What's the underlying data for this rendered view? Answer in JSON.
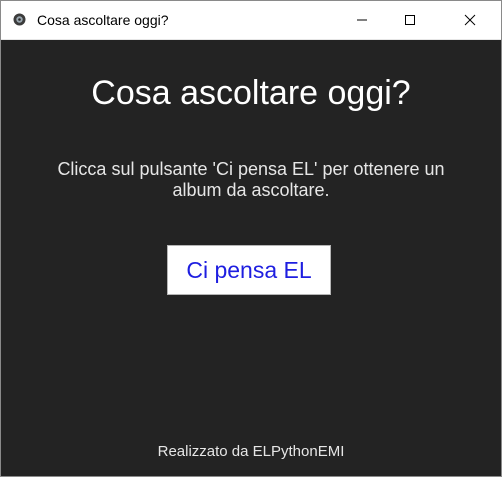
{
  "window": {
    "title": "Cosa ascoltare oggi?",
    "app_icon": "feather-app-icon",
    "controls": {
      "minimize_icon": "minimize-icon",
      "maximize_icon": "maximize-icon",
      "close_icon": "close-icon"
    }
  },
  "main": {
    "heading": "Cosa ascoltare oggi?",
    "instructions": "Clicca sul pulsante 'Ci pensa EL' per ottenere un album da ascoltare.",
    "button_label": "Ci pensa EL",
    "footer": "Realizzato da ELPythonEMI"
  },
  "colors": {
    "background": "#232323",
    "titlebar": "#ffffff",
    "button_text": "#1e1ee0",
    "text": "#ffffff"
  }
}
